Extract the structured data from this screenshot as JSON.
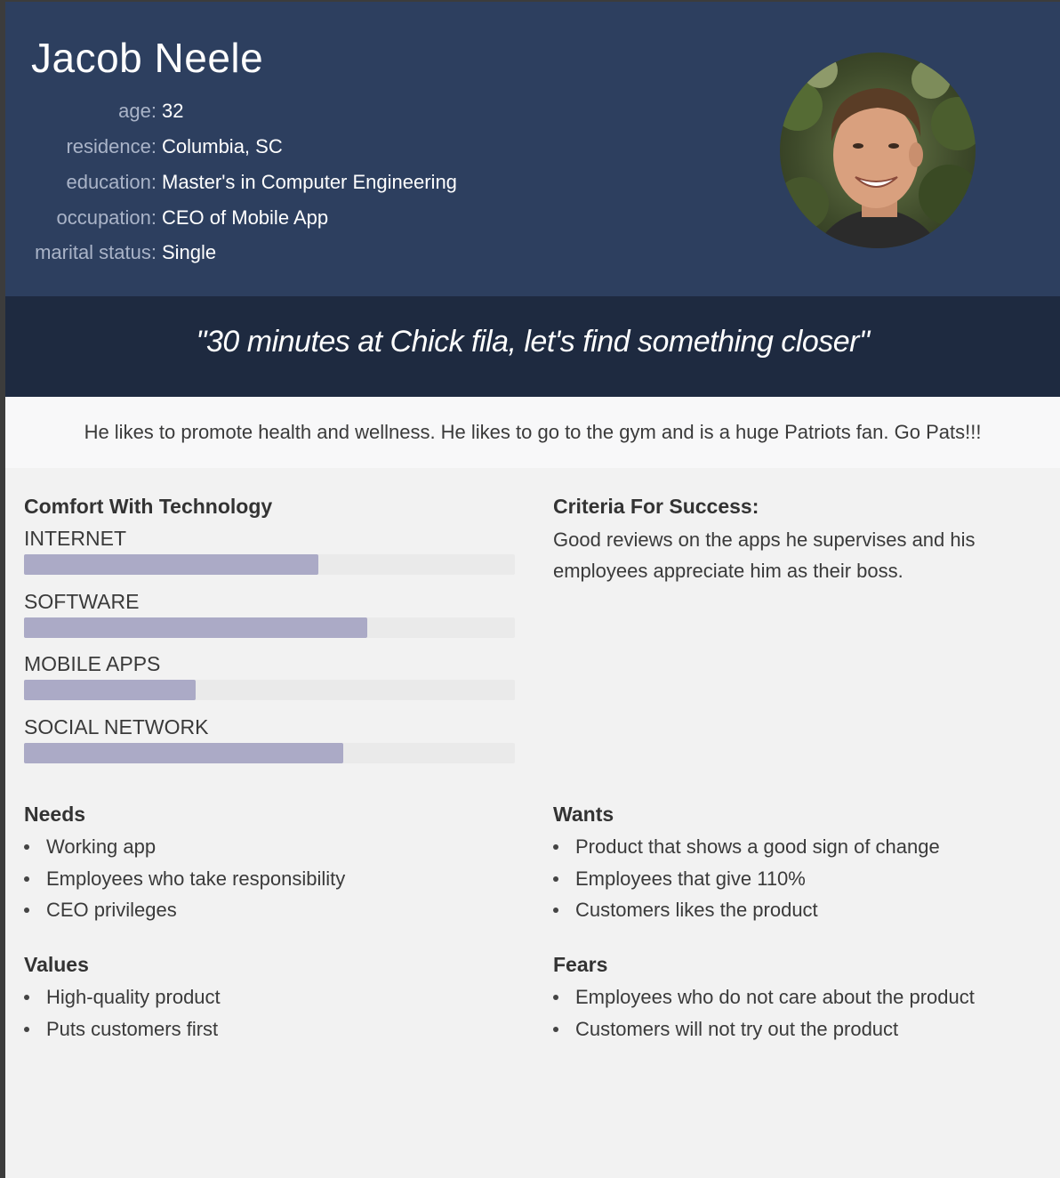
{
  "persona": {
    "name": "Jacob Neele",
    "attributes": [
      {
        "label": "age:",
        "value": "32"
      },
      {
        "label": "residence:",
        "value": "Columbia, SC"
      },
      {
        "label": "education:",
        "value": "Master's in Computer Engineering"
      },
      {
        "label": "occupation:",
        "value": "CEO of Mobile App"
      },
      {
        "label": "marital status:",
        "value": "Single"
      }
    ],
    "quote": "\"30 minutes at Chick fila, let's find something closer\"",
    "bio": "He likes to promote health and wellness. He likes to go to the gym and is a huge Patriots fan. Go Pats!!!"
  },
  "comfort": {
    "title": "Comfort With Technology",
    "bars": [
      {
        "label": "INTERNET",
        "percent": 60
      },
      {
        "label": "SOFTWARE",
        "percent": 70
      },
      {
        "label": "MOBILE APPS",
        "percent": 35
      },
      {
        "label": "SOCIAL NETWORK",
        "percent": 65
      }
    ]
  },
  "criteria": {
    "title": "Criteria For Success:",
    "text": "Good reviews on the apps he supervises and his employees appreciate him as their boss."
  },
  "needs": {
    "title": "Needs",
    "items": [
      "Working app",
      "Employees who take responsibility",
      "CEO privileges"
    ]
  },
  "wants": {
    "title": "Wants",
    "items": [
      "Product that shows a good sign of change",
      "Employees that give 110%",
      "Customers likes the product"
    ]
  },
  "values": {
    "title": "Values",
    "items": [
      "High-quality product",
      "Puts customers first"
    ]
  },
  "fears": {
    "title": "Fears",
    "items": [
      "Employees who do not care about the product",
      "Customers will not try out the product"
    ]
  },
  "colors": {
    "header_bg": "#2d3f5f",
    "quote_bg": "#1e2a40",
    "bar_fill": "#abaac6",
    "bar_track": "#eaeaea",
    "page_bg": "#f2f2f2"
  }
}
